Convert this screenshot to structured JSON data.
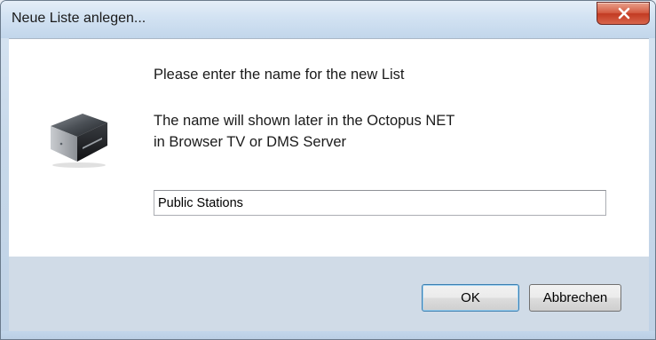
{
  "window": {
    "title": "Neue Liste anlegen...",
    "close_icon": "close-x-icon"
  },
  "message": {
    "line1": "Please enter the name for the new List",
    "line2": "The name will shown later in the Octopus NET",
    "line3": "in Browser TV or DMS Server"
  },
  "icon": {
    "name": "octopus-net-device-icon"
  },
  "input": {
    "value": "Public Stations",
    "placeholder": ""
  },
  "buttons": {
    "ok_label": "OK",
    "cancel_label": "Abbrechen"
  },
  "colors": {
    "close_button": "#c23a22",
    "footer_bg": "#d0dbe7",
    "titlebar_bg": "#d2e2f2",
    "default_button_border": "#3c7fb1"
  }
}
